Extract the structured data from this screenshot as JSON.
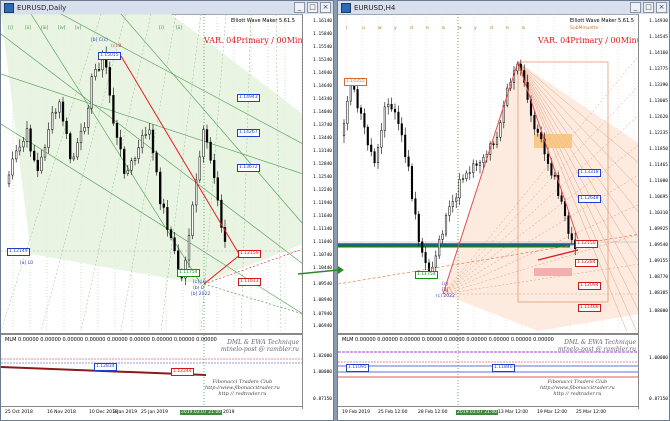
{
  "left": {
    "title": "EURUSD,Daily",
    "ea_info": "Elliott Wave Maker 5.61.5",
    "var_label": "VAR. 04Primary / 00Minute",
    "price_ticks": [
      "1.16140",
      "1.15840",
      "1.15540",
      "1.15240",
      "1.14940",
      "1.14640",
      "1.14340",
      "1.14040",
      "1.13740",
      "1.13440",
      "1.13140",
      "1.12840",
      "1.12540",
      "1.12240",
      "1.11940",
      "1.11640",
      "1.11340",
      "1.11040",
      "1.10740",
      "1.10440",
      "1.09540",
      "1.08940",
      "1.07940",
      "1.06940"
    ],
    "indicator_label": "MLM 0.00000 0.00000 0.00000 0.00000 0.00000 0.00000 0.00000 0.00000 0.00000",
    "indicator_right": [
      "1.02000",
      "1.00000",
      "0.87150"
    ],
    "dates": [
      "25 Oct 2018",
      "16 Nov 2018",
      "10 Dec 2018",
      "3 Jan 2019",
      "25 Jan 2019",
      "2019.03.07 21:00",
      "2019"
    ],
    "boxes": [
      "1.15015",
      "1.14943",
      "1.14267",
      "1.13672",
      "1.12149",
      "1.11754",
      "1.12159",
      "1.11613",
      "1.12834",
      "1.12244"
    ],
    "wave_labels": [
      "[b] C(c)",
      "(c) B",
      "[a] L0",
      "[c] L0",
      "(b) D",
      "[b] 2022",
      "[i]",
      "[ii]",
      "[iii]",
      "[iv]",
      "[v]",
      "[i]",
      "[ii]"
    ],
    "tech_lines": [
      "DML & EWA Technique",
      "mtnelo-post @ rambler.ru"
    ],
    "fib_lines": [
      "Fibonacci  Traders  Club",
      "http://www.fibonaccitrader.ru",
      "http  //  redtrader.ru"
    ]
  },
  "right": {
    "title": "EURUSD,H4",
    "ea_info": "Elliott Wave Maker 5.61.5",
    "sub_info": "SubMinuette",
    "var_label": "VAR. 04Primary / 00Minute",
    "price_ticks": [
      "1.14930",
      "1.14545",
      "1.14160",
      "1.13775",
      "1.13390",
      "1.13005",
      "1.12620",
      "1.12235",
      "1.11850",
      "1.11465",
      "1.11080",
      "1.10695",
      "1.10310",
      "1.09925",
      "1.09540",
      "1.09155",
      "1.08770",
      "1.08385",
      "1.08000"
    ],
    "indicator_right": [
      "1.00000",
      "0.87150"
    ],
    "top_letters": [
      "i",
      "u",
      "w",
      "y",
      "d",
      "e",
      "a",
      "w",
      "y",
      "d",
      "e",
      "a"
    ],
    "dates": [
      "19 Feb 2019",
      "25 Feb 12:00",
      "28 Feb 12:00",
      "2019.03.07 21:00",
      "13 Mar 12:00",
      "19 Mar 12:00",
      "25 Mar 12:00"
    ],
    "boxes": [
      "1.14355",
      "1.13318",
      "1.12648",
      "1.12284",
      "1.12094",
      "1.11754",
      "1.12150",
      "1.11466",
      "1.11095",
      "1.11840"
    ],
    "wave_labels": [
      "(c)",
      "[3]",
      "(c) 2022"
    ],
    "tech_lines": [
      "DML & EWA Technique",
      "mtnelo-post @ rambler.ru"
    ],
    "fib_lines": [
      "Fibonacci  Traders  Club",
      "http://www.fibonaccitrader.ru",
      "http  //  redtrader.ru"
    ]
  },
  "colors": {
    "var": "#e01818",
    "box_blue": "#1f3fcc",
    "box_red": "#d01818",
    "box_green": "#1a8a1a",
    "grid_green": "#5aa05a",
    "fib_orange": "#e07030",
    "highlight": "#3a8a3a"
  }
}
